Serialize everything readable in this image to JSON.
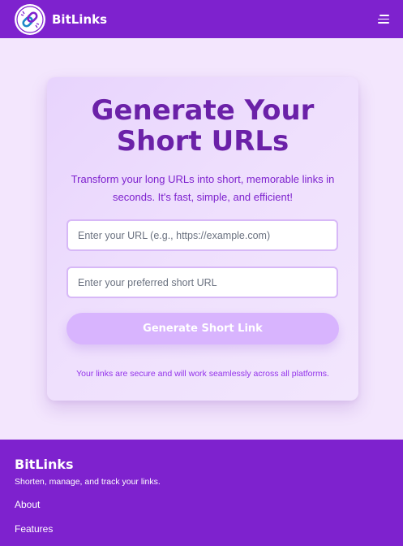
{
  "header": {
    "brand_name": "BitLinks"
  },
  "hero": {
    "headline_line1": "Generate Your",
    "headline_line2": "Short URLs",
    "subtitle": "Transform your long URLs into short, memorable links in seconds. It's fast, simple, and efficient!",
    "url_input": {
      "placeholder": "Enter your URL (e.g., https://example.com)",
      "value": ""
    },
    "short_input": {
      "placeholder": "Enter your preferred short URL",
      "value": ""
    },
    "generate_label": "Generate Short Link",
    "note": "Your links are secure and will work seamlessly across all platforms."
  },
  "footer": {
    "title": "BitLinks",
    "tagline": "Shorten, manage, and track your links.",
    "links": [
      "About",
      "Features"
    ]
  },
  "colors": {
    "primary": "#7e22ce",
    "headline": "#6b21a8",
    "button": "#d8b4fe",
    "page_bg": "#f3e6fd"
  },
  "icons": {
    "logo": "chain-link-icon",
    "menu": "hamburger-menu-icon"
  }
}
